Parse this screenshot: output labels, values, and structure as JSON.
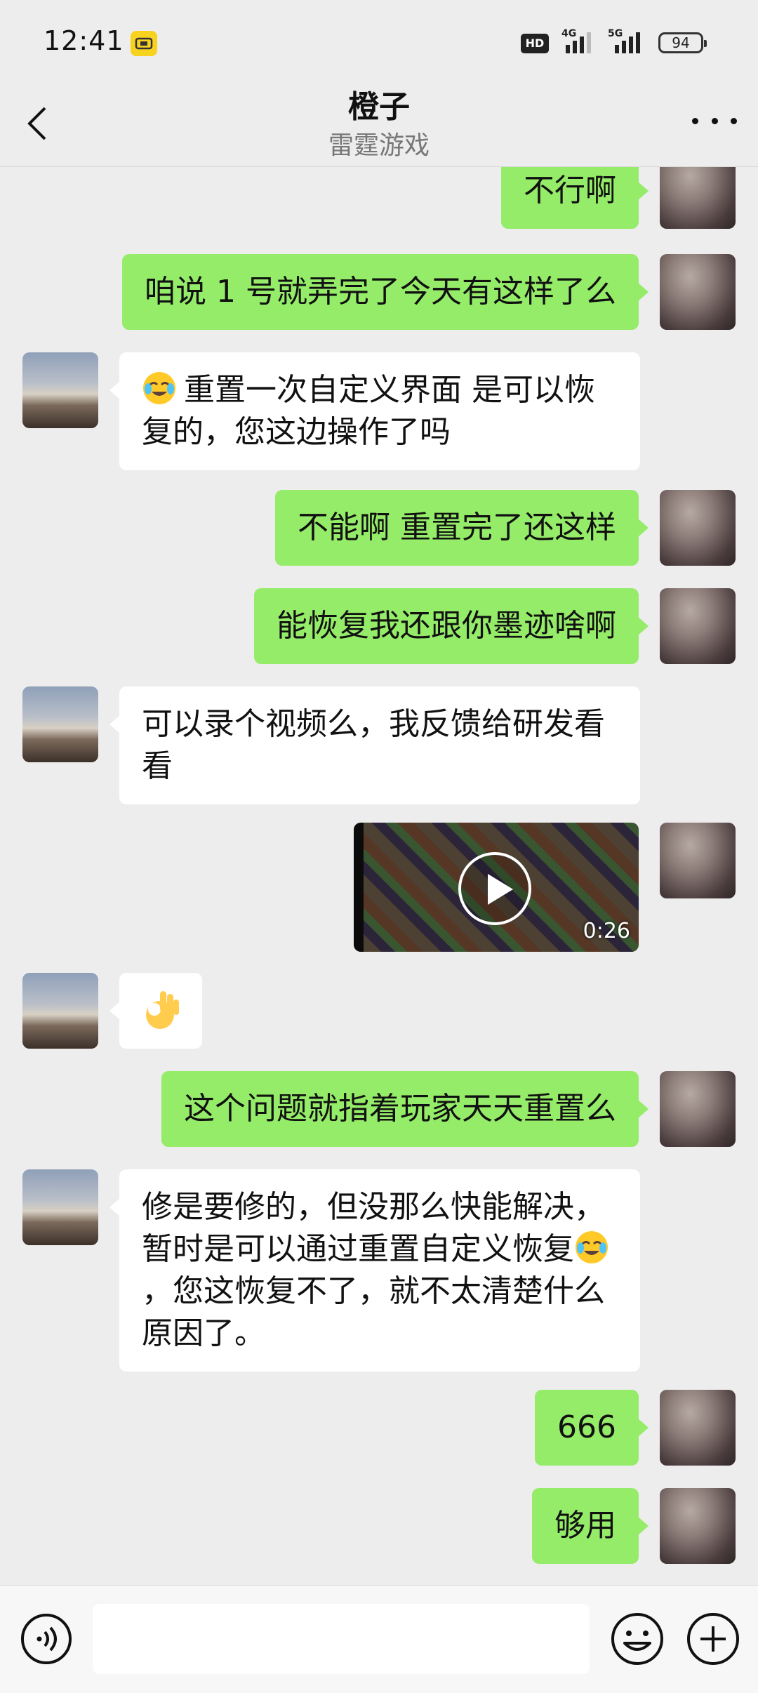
{
  "status_bar": {
    "time": "12:41",
    "hd_label": "HD",
    "network_1": "4G",
    "network_2": "5G",
    "battery": "94"
  },
  "header": {
    "title": "橙子",
    "subtitle": "雷霆游戏"
  },
  "messages": [
    {
      "from": "self",
      "type": "text",
      "text": "不行啊"
    },
    {
      "from": "self",
      "type": "text",
      "text": "咱说 1 号就弄完了今天有这样了么"
    },
    {
      "from": "other",
      "type": "text",
      "emoji": "face-with-tears-emoji",
      "text": "重置一次自定义界面 是可以恢复的，您这边操作了吗"
    },
    {
      "from": "self",
      "type": "text",
      "text": "不能啊  重置完了还这样"
    },
    {
      "from": "self",
      "type": "text",
      "text": "能恢复我还跟你墨迹啥啊"
    },
    {
      "from": "other",
      "type": "text",
      "text": "可以录个视频么，我反馈给研发看看"
    },
    {
      "from": "self",
      "type": "video",
      "duration": "0:26"
    },
    {
      "from": "other",
      "type": "emoji",
      "emoji": "ok-hand-emoji"
    },
    {
      "from": "self",
      "type": "text",
      "text": "这个问题就指着玩家天天重置么"
    },
    {
      "from": "other",
      "type": "text",
      "text_before": "修是要修的，但没那么快能解决，暂时是可以通过重置自定义恢复",
      "emoji": "face-with-tears-emoji",
      "text_after": "，您这恢复不了，就不太清楚什么原因了。"
    },
    {
      "from": "self",
      "type": "text",
      "text": "666"
    },
    {
      "from": "self",
      "type": "text",
      "text": "够用"
    }
  ],
  "input_bar": {
    "placeholder": ""
  },
  "colors": {
    "background": "#ededed",
    "self_bubble": "#95ec69",
    "other_bubble": "#ffffff"
  }
}
